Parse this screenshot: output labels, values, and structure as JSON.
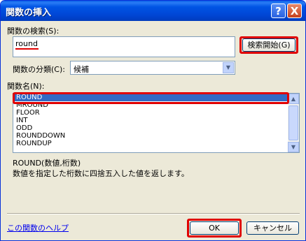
{
  "window": {
    "title": "関数の挿入"
  },
  "title_buttons": {
    "help": "?",
    "close": "X"
  },
  "search": {
    "label": "関数の検索(S):",
    "value": "round",
    "button_label": "検索開始(G)"
  },
  "category": {
    "label": "関数の分類(C):",
    "value": "候補",
    "dropdown_glyph": "▼"
  },
  "function_list": {
    "label": "関数名(N):",
    "items": [
      "ROUND",
      "MROUND",
      "FLOOR",
      "INT",
      "ODD",
      "ROUNDDOWN",
      "ROUNDUP"
    ],
    "scroll_up_glyph": "▲",
    "scroll_down_glyph": "▼"
  },
  "description": {
    "syntax": "ROUND(数値,桁数)",
    "text": "数値を指定した桁数に四捨五入した値を返します。"
  },
  "footer": {
    "help_link": "この関数のヘルプ",
    "ok_label": "OK",
    "cancel_label": "キャンセル"
  },
  "colors": {
    "titlebar": "#0055e5",
    "highlight": "#e00000",
    "selection": "#316ac5",
    "dialog_bg": "#ece9d8"
  }
}
